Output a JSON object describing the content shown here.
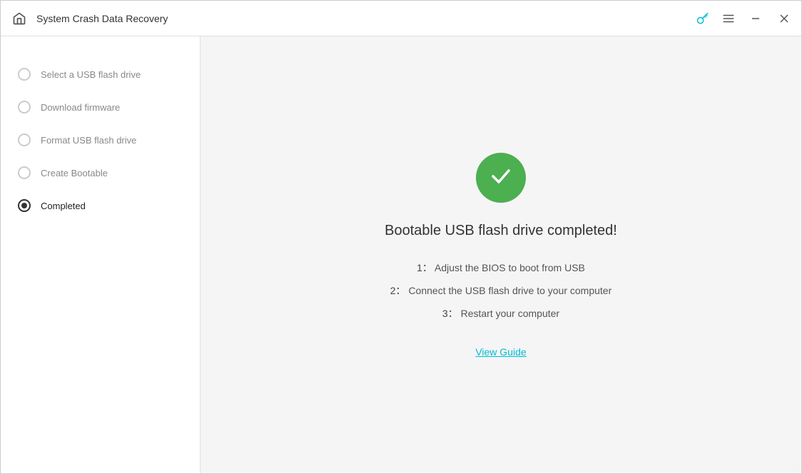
{
  "titleBar": {
    "title": "System Crash Data Recovery",
    "homeIcon": "🏠",
    "keyIcon": "🔑",
    "menuIcon": "☰",
    "minimizeIcon": "—",
    "closeIcon": "✕"
  },
  "sidebar": {
    "items": [
      {
        "id": "select-usb",
        "label": "Select a USB flash drive",
        "state": "default"
      },
      {
        "id": "download-firmware",
        "label": "Download firmware",
        "state": "default"
      },
      {
        "id": "format-usb",
        "label": "Format USB flash drive",
        "state": "default"
      },
      {
        "id": "create-bootable",
        "label": "Create Bootable",
        "state": "default"
      },
      {
        "id": "completed",
        "label": "Completed",
        "state": "active"
      }
    ]
  },
  "main": {
    "completionTitle": "Bootable USB flash drive completed!",
    "steps": [
      {
        "num": "1：",
        "text": "Adjust the BIOS to boot from USB"
      },
      {
        "num": "2：",
        "text": "Connect the USB flash drive to your computer"
      },
      {
        "num": "3：",
        "text": "Restart your computer"
      }
    ],
    "viewGuideLabel": "View Guide"
  }
}
